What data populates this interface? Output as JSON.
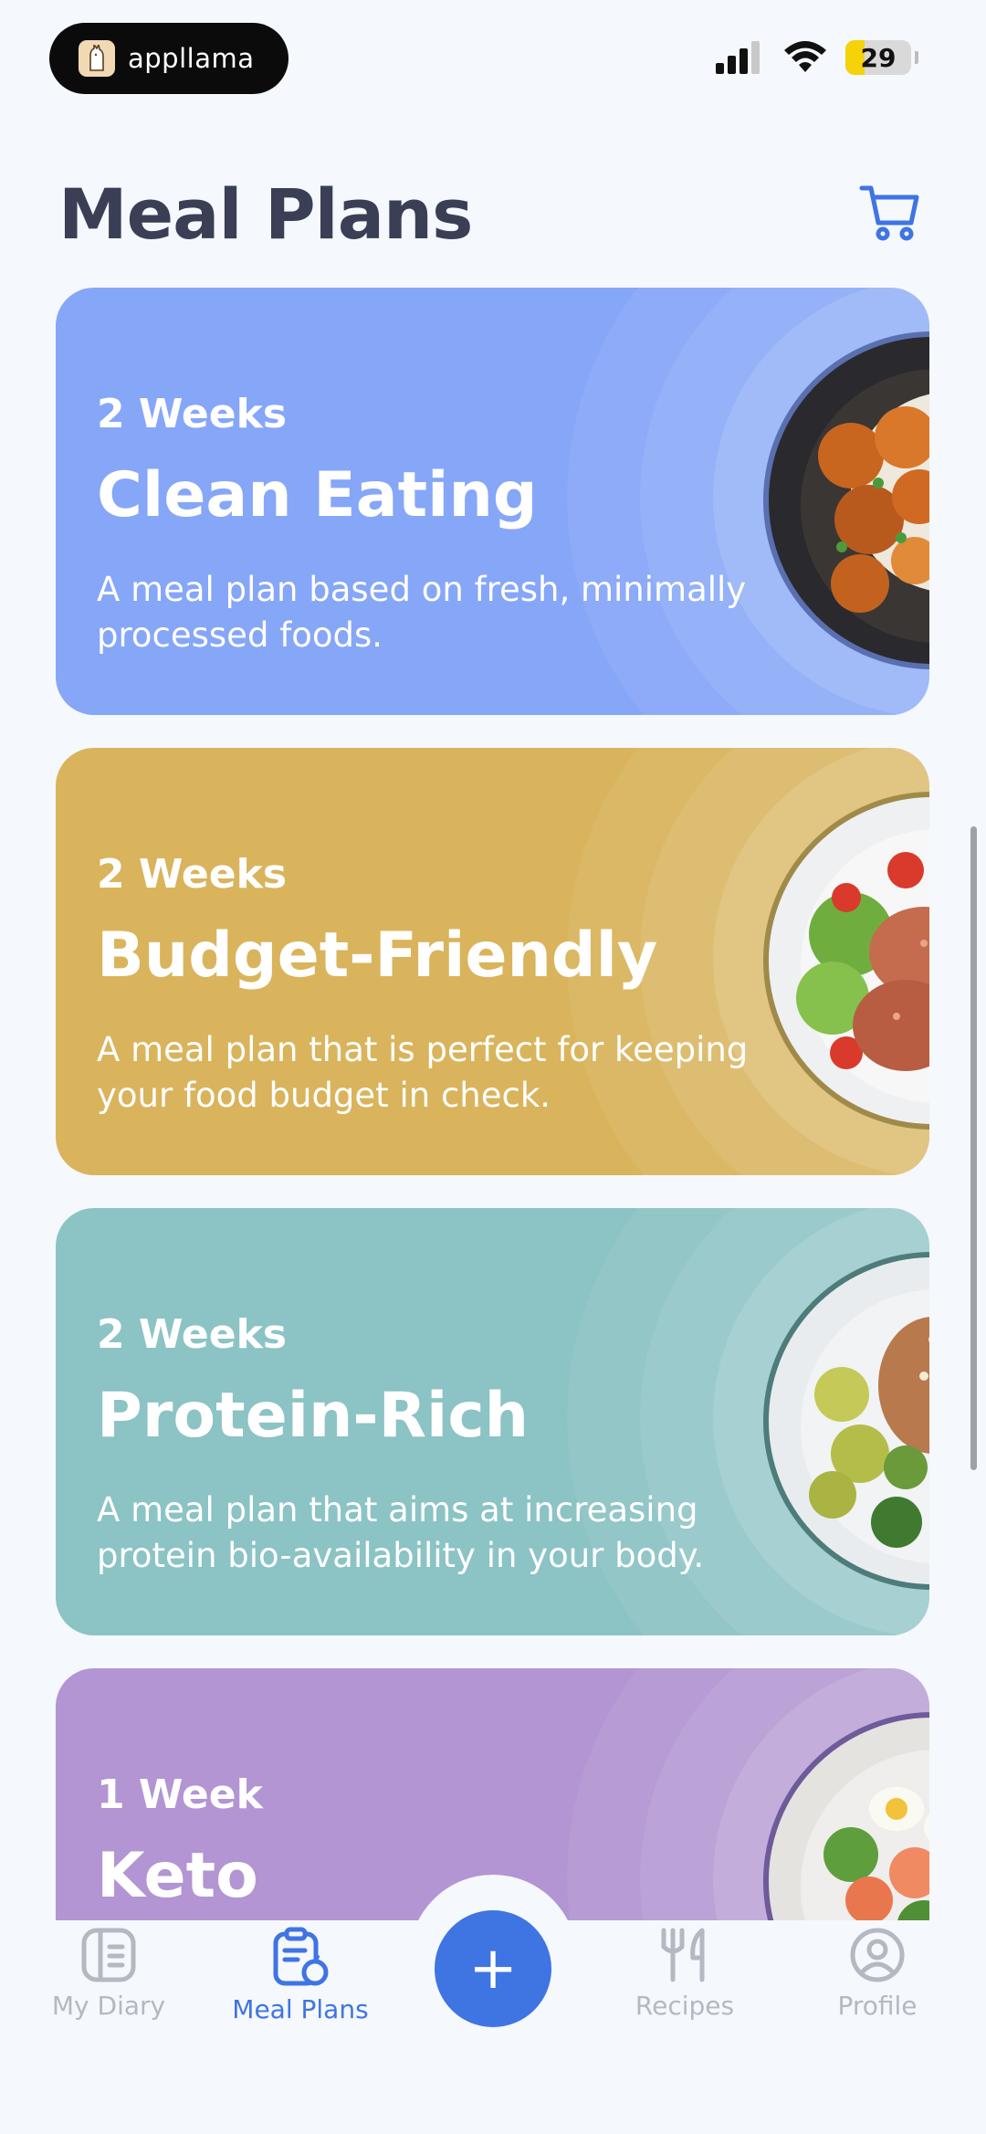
{
  "status_bar": {
    "app_name": "appllama",
    "battery": "29",
    "battery_level": 0.29
  },
  "header": {
    "title": "Meal Plans"
  },
  "plans": [
    {
      "duration": "2 Weeks",
      "name": "Clean Eating",
      "description": "A meal plan based on fresh, minimally processed foods.",
      "color": "#86a6f8"
    },
    {
      "duration": "2 Weeks",
      "name": "Budget-Friendly",
      "description": "A meal plan that is perfect for keeping your food budget in check.",
      "color": "#d9b45c"
    },
    {
      "duration": "2 Weeks",
      "name": "Protein-Rich",
      "description": "A meal plan that aims at increasing protein bio-availability in your body.",
      "color": "#8cc3c4"
    },
    {
      "duration": "1 Week",
      "name": "Keto",
      "description": "",
      "color": "#b295d2"
    }
  ],
  "tabs": [
    {
      "label": "My Diary",
      "icon": "diary-icon"
    },
    {
      "label": "Meal Plans",
      "icon": "meal-plans-icon",
      "active": true
    },
    {
      "label": "Recipes",
      "icon": "recipes-icon"
    },
    {
      "label": "Profile",
      "icon": "profile-icon"
    }
  ],
  "fab": {
    "symbol": "+"
  },
  "colors": {
    "accent": "#3f74e3",
    "background": "#f5f8fc",
    "title": "#3b3f55",
    "inactive_tab": "#b4b8c2"
  }
}
